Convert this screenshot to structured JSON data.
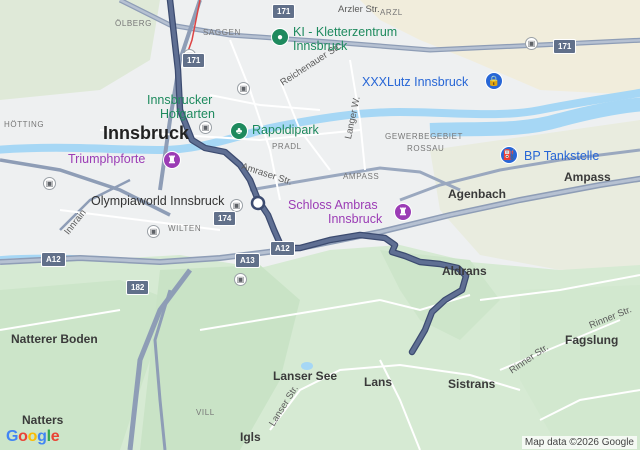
{
  "colors": {
    "route": "#5f6f93",
    "route_outline": "#3c4b70",
    "water": "#a6d7f5",
    "forest": "#cfe7cd",
    "urban": "#e4e6ea",
    "highway": "#8e9db6",
    "road": "#ffffff"
  },
  "cities": {
    "innsbruck": "Innsbruck"
  },
  "towns": {
    "aldrans": "Aldrans",
    "ampass": "Ampass",
    "agenbach": "Agenbach",
    "lans": "Lans",
    "sistrans": "Sistrans",
    "fagslung": "Fagslung",
    "igls": "Igls",
    "natters": "Natters",
    "natterer_boden": "Natterer Boden",
    "lanser_see": "Lanser See"
  },
  "districts": {
    "olberg": "ÖLBERG",
    "saggen": "SAGGEN",
    "hotting": "HÖTTING",
    "pradl": "PRADL",
    "ampass_area": "AMPASS",
    "wilten": "WILTEN",
    "arzl": "ARZL",
    "gewerbegebiet": "GEWERBEGEBIET",
    "rossau": "ROSSAU",
    "vill": "VILL"
  },
  "streets": {
    "arzler": "Arzler Str.",
    "reichenauer": "Reichenauer Str.",
    "langer_weg": "Langer W.",
    "amraser": "Amraser Str.",
    "innrain": "Innrain",
    "rinner1": "Rinner Str.",
    "rinner2": "Rinner Str.",
    "lanser": "Lanser Str."
  },
  "pois": {
    "kletterzentrum_1": "KI - Kletterzentrum",
    "kletterzentrum_2": "Innsbruck",
    "xxxlutz": "XXXLutz Innsbruck",
    "hofgarten_1": "Innsbrucker",
    "hofgarten_2": "Hofgarten",
    "rapoldipark": "Rapoldipark",
    "triumphpforte": "Triumphpforte",
    "olympiaworld": "Olympiaworld Innsbruck",
    "schloss_1": "Schloss Ambras",
    "schloss_2": "Innsbruck",
    "bp": "BP Tankstelle"
  },
  "shields": {
    "a171_top": "171",
    "a171_left": "171",
    "a171_right": "171",
    "a174": "174",
    "a12_left": "A12",
    "a12_mid": "A12",
    "a13": "A13",
    "a182": "182"
  },
  "icons": {
    "kletter": "pin-green-icon",
    "xxxlutz": "shopping-bag-icon",
    "rapoldi": "tree-icon",
    "triumph": "monument-icon",
    "schloss": "castle-icon",
    "bp": "fuel-icon",
    "rail": "train-station-icon"
  },
  "branding": {
    "logo": "Google",
    "attribution": "Map data ©2026 Google"
  }
}
